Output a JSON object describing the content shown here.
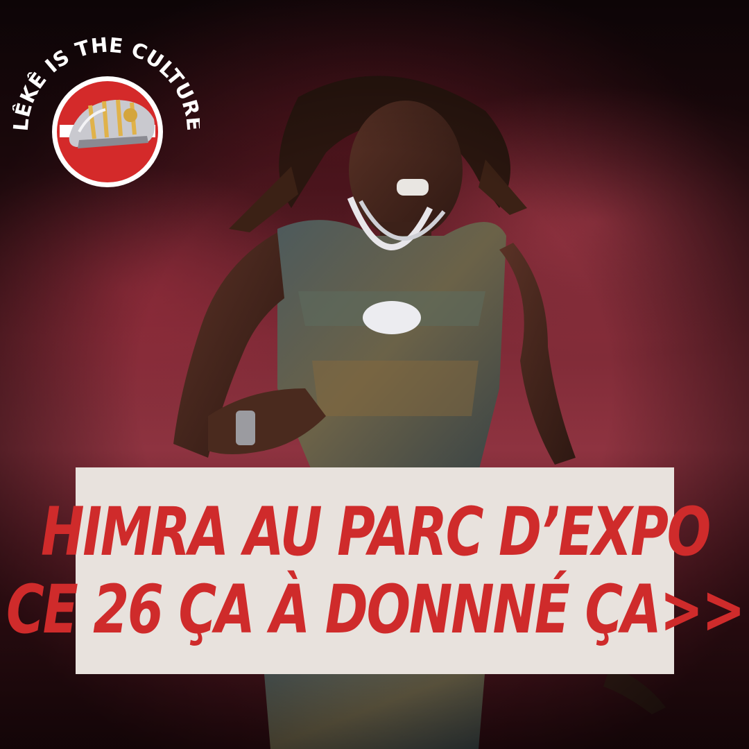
{
  "logo": {
    "text": "LÊKÊ IS THE CULTURE",
    "icon": "sandal-icon",
    "circle_color": "#d42a2a"
  },
  "headline": {
    "line1": "HIMRA AU PARC D’EXPO",
    "line2": "CE 26 ÇA À DONNNÉ ÇA>>",
    "text_color": "#cf2b2b",
    "box_color": "#e8e2dd"
  }
}
